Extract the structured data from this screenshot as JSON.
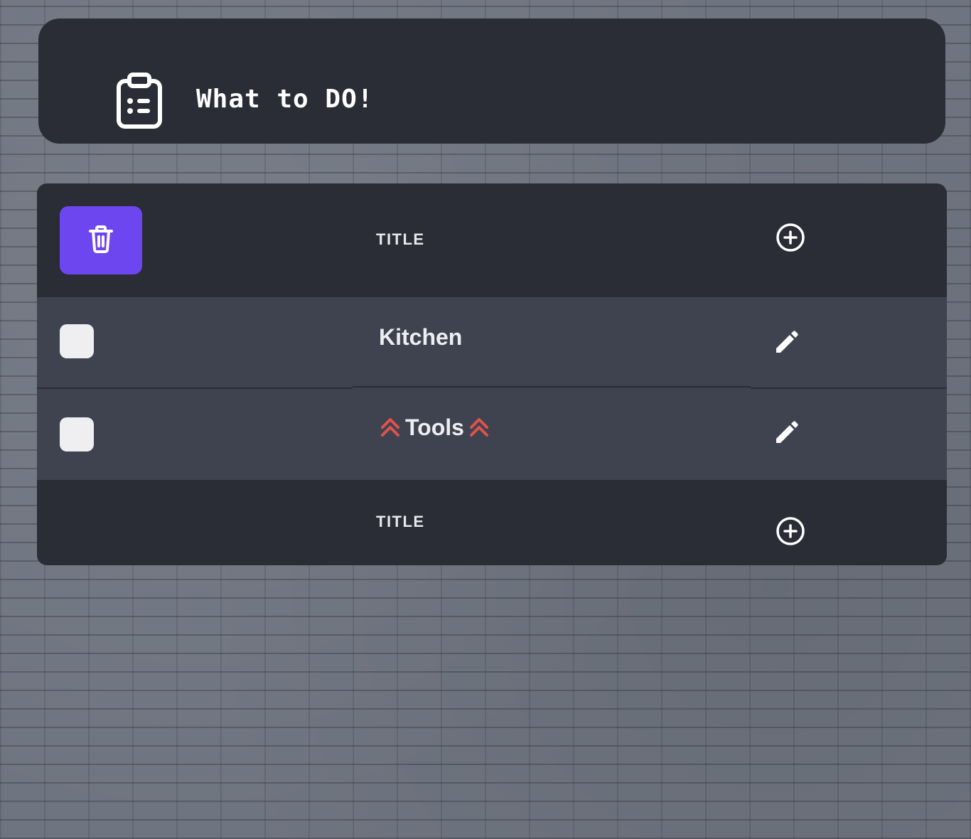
{
  "header": {
    "title": "What to DO!",
    "icon": "clipboard-list-icon"
  },
  "colors": {
    "panel": "#2a2c36",
    "row": "#3f4350",
    "accent": "#6e46ef",
    "priority": "#e0524a",
    "text": "#ffffff"
  },
  "table": {
    "header": {
      "title_label": "TITLE",
      "delete_icon": "trash-icon",
      "add_icon": "plus-circle-icon"
    },
    "rows": [
      {
        "name": "Kitchen",
        "priority": false,
        "edit_icon": "pencil-icon"
      },
      {
        "name": "Tools",
        "priority": true,
        "priority_icon": "chevrons-up-icon",
        "edit_icon": "pencil-icon"
      }
    ],
    "footer": {
      "title_label": "TITLE",
      "add_icon": "plus-circle-icon"
    }
  }
}
